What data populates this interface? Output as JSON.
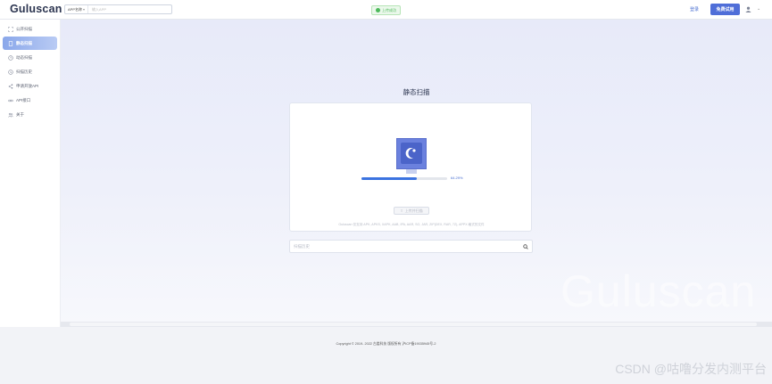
{
  "header": {
    "logo": "Guluscan",
    "search_type": "APP名称",
    "search_placeholder": "输入APP",
    "status": "上传成功",
    "login": "登录",
    "trial_button": "免费试用"
  },
  "sidebar": {
    "items": [
      {
        "label": "公开扫描",
        "icon": "scan-icon"
      },
      {
        "label": "静态扫描",
        "icon": "document-icon",
        "active": true
      },
      {
        "label": "动态扫描",
        "icon": "clock-icon"
      },
      {
        "label": "扫描历史",
        "icon": "history-icon"
      },
      {
        "label": "申请开放API",
        "icon": "share-icon"
      },
      {
        "label": "API接口",
        "icon": "link-icon"
      },
      {
        "label": "关于",
        "icon": "people-icon"
      }
    ]
  },
  "main": {
    "title": "静态扫描",
    "progress": {
      "value": 0.6429,
      "label": "64.29%"
    },
    "upload_button": "上传并扫描",
    "note": "Guluscan 仅支持 APK, APKS, XAPK, AAB, IPA, AAR, SO, JAR, ZIP(DEX, RAR, 7Z), APPX 格式的文件",
    "history_placeholder": "扫描历史",
    "watermark": "Guluscan"
  },
  "footer": {
    "copyright": "Copyright © 2019- 2022 古娄科技 版权所有 沪ICP备19035945号-2",
    "csdn": "CSDN @咕噜分发内测平台"
  },
  "colors": {
    "accent": "#4f6ed8",
    "success": "#4cb95a",
    "progress": "#3b73e0"
  }
}
